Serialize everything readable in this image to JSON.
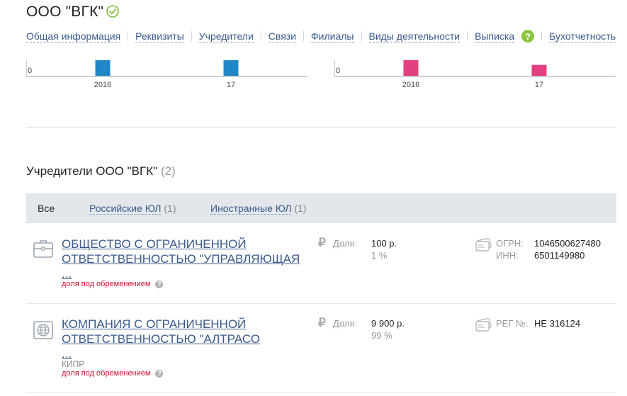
{
  "company": {
    "title": "ООО \"ВГК\""
  },
  "nav": {
    "items": [
      "Общая информация",
      "Реквизиты",
      "Учредители",
      "Связи",
      "Филиалы",
      "Виды деятельности",
      "Выписка",
      "Бухотчетность"
    ],
    "help": "?"
  },
  "charts": [
    {
      "type": "bar",
      "zero_label": "0",
      "categories": [
        "2016",
        "17"
      ],
      "values": [
        1,
        1
      ],
      "color": "#1f86c8"
    },
    {
      "type": "bar",
      "zero_label": "0",
      "categories": [
        "2016",
        "17"
      ],
      "values": [
        1,
        0.7
      ],
      "color": "#e3407f"
    }
  ],
  "chart_data": [
    {
      "type": "bar",
      "categories": [
        "2016",
        "17"
      ],
      "values": [
        1,
        1
      ],
      "ylim": [
        0,
        1
      ],
      "color": "#1f86c8"
    },
    {
      "type": "bar",
      "categories": [
        "2016",
        "17"
      ],
      "values": [
        1,
        0.7
      ],
      "ylim": [
        0,
        1
      ],
      "color": "#e3407f"
    }
  ],
  "founders": {
    "title": "Учредители ООО \"ВГК\"",
    "count": "(2)",
    "filters": {
      "all": "Все",
      "russian": "Российские ЮЛ",
      "russian_count": "(1)",
      "foreign": "Иностранные ЮЛ",
      "foreign_count": "(1)"
    },
    "entries": [
      {
        "name_line1": "ОБЩЕСТВО С ОГРАНИЧЕННОЙ",
        "name_line2": "ОТВЕТСТВЕННОСТЬЮ \"УПРАВЛЯЮЩАЯ",
        "name_line3": "...",
        "country": "",
        "note": "доля под обременением",
        "share_label": "Доля:",
        "share_value": "100 р.",
        "share_percent": "1 %",
        "id1_label": "ОГРН:",
        "id1_value": "1046500627480",
        "id2_label": "ИНН:",
        "id2_value": "6501149980"
      },
      {
        "name_line1": "КОМПАНИЯ С ОГРАНИЧЕННОЙ",
        "name_line2": "ОТВЕТСТВЕННОСТЬЮ \"АЛТРАСО",
        "name_line3": "...",
        "country": "КИПР",
        "note": "доля под обременением",
        "share_label": "Доля:",
        "share_value": "9 900 р.",
        "share_percent": "99 %",
        "id1_label": "РЕГ №:",
        "id1_value": "НЕ 316124"
      }
    ]
  }
}
